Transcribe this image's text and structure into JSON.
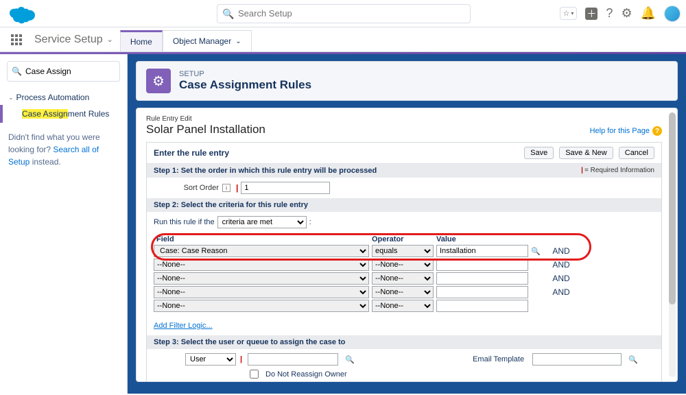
{
  "header": {
    "search_placeholder": "Search Setup"
  },
  "nav": {
    "app_name": "Service Setup",
    "tabs": [
      {
        "label": "Home"
      },
      {
        "label": "Object Manager"
      }
    ]
  },
  "sidebar": {
    "quick_find_value": "Case Assign",
    "section": "Process Automation",
    "item_prefix": "Case Assign",
    "item_suffix": "ment Rules",
    "not_found_prefix": "Didn't find what you were looking for? ",
    "not_found_link": "Search all of Setup",
    "not_found_suffix": " instead."
  },
  "setup_header": {
    "eyebrow": "SETUP",
    "title": "Case Assignment Rules"
  },
  "page": {
    "crumb": "Rule Entry Edit",
    "title": "Solar Panel Installation",
    "help": "Help for this Page"
  },
  "form": {
    "section_title": "Enter the rule entry",
    "btn_save": "Save",
    "btn_save_new": "Save & New",
    "btn_cancel": "Cancel",
    "required_info": "= Required Information",
    "step1_num": "Step 1:",
    "step1_txt": " Set the order in which this rule entry will be processed",
    "sort_order_label": "Sort Order",
    "sort_order_value": "1",
    "step2_num": "Step 2:",
    "step2_txt": " Select the criteria for this rule entry",
    "run_rule_label": "Run this rule if the ",
    "run_rule_select": "criteria are met",
    "col_field": "Field",
    "col_operator": "Operator",
    "col_value": "Value",
    "and": "AND",
    "criteria": [
      {
        "field": "Case: Case Reason",
        "operator": "equals",
        "value": "Installation"
      },
      {
        "field": "--None--",
        "operator": "--None--",
        "value": ""
      },
      {
        "field": "--None--",
        "operator": "--None--",
        "value": ""
      },
      {
        "field": "--None--",
        "operator": "--None--",
        "value": ""
      },
      {
        "field": "--None--",
        "operator": "--None--",
        "value": ""
      }
    ],
    "add_filter": "Add Filter Logic...",
    "step3_num": "Step 3:",
    "step3_txt": " Select the user or queue to assign the case to",
    "assign_type": "User",
    "reassign_label": "Do Not Reassign Owner",
    "email_template_label": "Email Template"
  }
}
